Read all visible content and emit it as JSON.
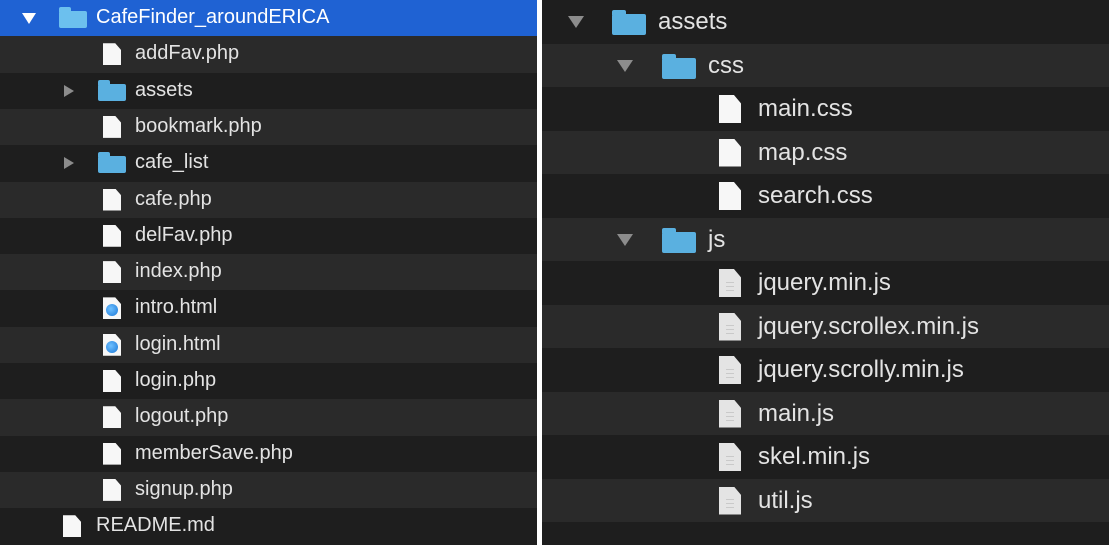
{
  "left_panel": {
    "rows": [
      {
        "label": "CafeFinder_aroundERICA",
        "type": "folder",
        "expanded": true,
        "selected": true
      },
      {
        "label": "addFav.php",
        "type": "file"
      },
      {
        "label": "assets",
        "type": "folder",
        "expanded": false
      },
      {
        "label": "bookmark.php",
        "type": "file"
      },
      {
        "label": "cafe_list",
        "type": "folder",
        "expanded": false
      },
      {
        "label": "cafe.php",
        "type": "file"
      },
      {
        "label": "delFav.php",
        "type": "file"
      },
      {
        "label": "index.php",
        "type": "file"
      },
      {
        "label": "intro.html",
        "type": "html"
      },
      {
        "label": "login.html",
        "type": "html"
      },
      {
        "label": "login.php",
        "type": "file"
      },
      {
        "label": "logout.php",
        "type": "file"
      },
      {
        "label": "memberSave.php",
        "type": "file"
      },
      {
        "label": "signup.php",
        "type": "file"
      },
      {
        "label": "README.md",
        "type": "file"
      }
    ]
  },
  "right_panel": {
    "rows": [
      {
        "label": "assets",
        "type": "folder",
        "expanded": true
      },
      {
        "label": "css",
        "type": "folder",
        "expanded": true
      },
      {
        "label": "main.css",
        "type": "file"
      },
      {
        "label": "map.css",
        "type": "file"
      },
      {
        "label": "search.css",
        "type": "file"
      },
      {
        "label": "js",
        "type": "folder",
        "expanded": true
      },
      {
        "label": "jquery.min.js",
        "type": "js"
      },
      {
        "label": "jquery.scrollex.min.js",
        "type": "js"
      },
      {
        "label": "jquery.scrolly.min.js",
        "type": "js"
      },
      {
        "label": "main.js",
        "type": "js"
      },
      {
        "label": "skel.min.js",
        "type": "js"
      },
      {
        "label": "util.js",
        "type": "js"
      }
    ]
  },
  "colors": {
    "selection": "#1f62d3",
    "folder": "#5ab0e0",
    "background": "#1e1e1e",
    "stripe": "#2a2a2a"
  }
}
